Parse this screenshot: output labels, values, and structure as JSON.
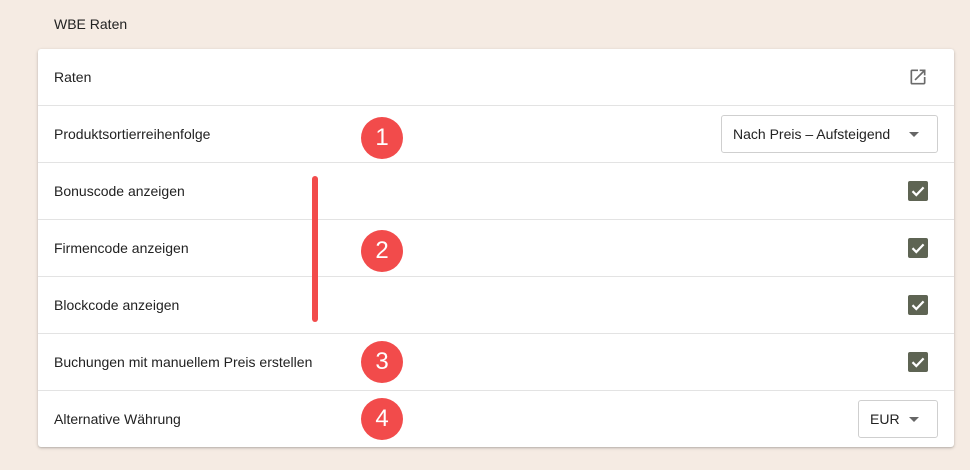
{
  "page": {
    "section_title": "WBE Raten"
  },
  "card": {
    "header": {
      "title": "Raten",
      "icon": "open-in-new-icon"
    },
    "rows": [
      {
        "label": "Produktsortierreihenfolge",
        "control": "select",
        "value": "Nach Preis – Aufsteigend"
      },
      {
        "label": "Bonuscode anzeigen",
        "control": "checkbox",
        "checked": true
      },
      {
        "label": "Firmencode anzeigen",
        "control": "checkbox",
        "checked": true
      },
      {
        "label": "Blockcode anzeigen",
        "control": "checkbox",
        "checked": true
      },
      {
        "label": "Buchungen mit manuellem Preis erstellen",
        "control": "checkbox",
        "checked": true
      },
      {
        "label": "Alternative Währung",
        "control": "select",
        "value": "EUR"
      }
    ]
  },
  "annotations": {
    "badges": [
      "1",
      "2",
      "3",
      "4"
    ],
    "color": "#f24b4b"
  },
  "colors": {
    "background": "#f5ebe3",
    "checkbox": "#5e6453"
  }
}
